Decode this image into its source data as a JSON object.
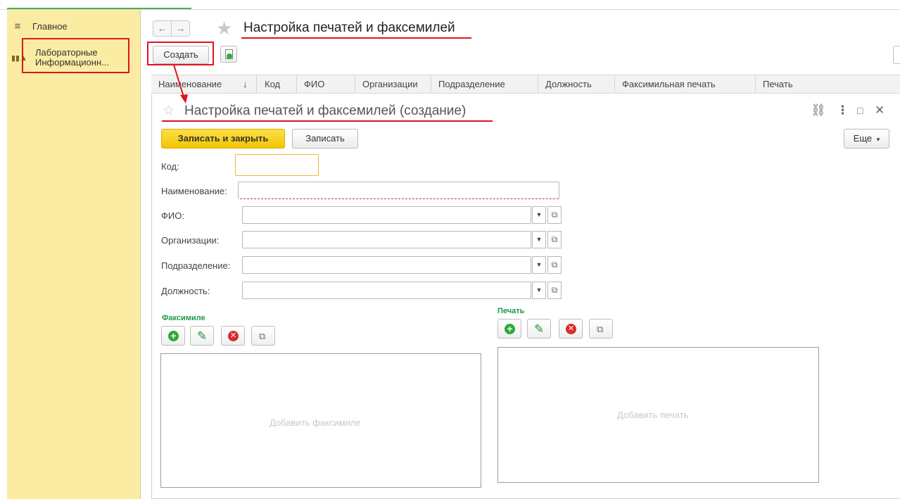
{
  "sidebar": {
    "items": [
      {
        "icon": "menu-icon",
        "label": "Главное"
      },
      {
        "icon": "chart-icon",
        "label": "Лабораторные Информационн..."
      }
    ]
  },
  "header": {
    "title": "Настройка печатей и факсемилей",
    "create_label": "Создать"
  },
  "table": {
    "columns": [
      "Наименование",
      "↓",
      "Код",
      "ФИО",
      "Организации",
      "Подразделение",
      "Должность",
      "Факсимильная печать",
      "Печать"
    ]
  },
  "form": {
    "title": "Настройка печатей и факсемилей (создание)",
    "save_close_label": "Записать и закрыть",
    "save_label": "Записать",
    "more_label": "Еще",
    "fields": {
      "code_label": "Код:",
      "name_label": "Наименование:",
      "fio_label": "ФИО:",
      "org_label": "Организации:",
      "dept_label": "Подразделение:",
      "position_label": "Должность:"
    },
    "facsimile": {
      "label": "Факсимиле",
      "placeholder": "Добавить факсимиле"
    },
    "stamp": {
      "label": "Печать",
      "placeholder": "Добавить печать"
    }
  },
  "annotation_color": "#e0141e",
  "accent_color": "#f2c500"
}
